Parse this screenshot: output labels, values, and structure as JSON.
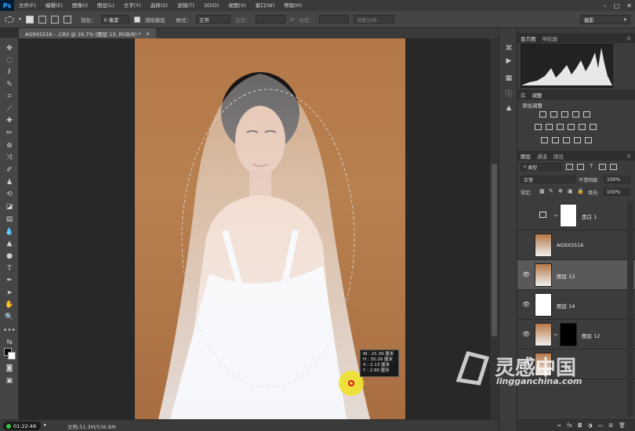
{
  "app": {
    "logo": "Ps"
  },
  "menu": [
    "文件(F)",
    "编辑(E)",
    "图像(I)",
    "图层(L)",
    "文字(Y)",
    "选择(S)",
    "滤镜(T)",
    "3D(D)",
    "视图(V)",
    "窗口(W)",
    "帮助(H)"
  ],
  "window_controls": [
    "–",
    "▢",
    "✕"
  ],
  "options": {
    "feather_label": "羽化：",
    "feather_value": "0 像素",
    "antialias_label": "消除锯齿",
    "style_label": "样式：",
    "style_value": "正常",
    "width_label": "宽度：",
    "height_label": "高度：",
    "refine_label": "调整边缘...",
    "workspace": "摄影"
  },
  "document": {
    "tab_title": "AG9X5516 - .CR2 @ 16.7% (图层 13, RGB/8) *",
    "close_glyph": "×"
  },
  "info_readout": {
    "w": "W :  21.39 厘米",
    "h": "H :  35.26 厘米",
    "x": "X :   2.13 厘米",
    "y": "Y :   2.90 厘米"
  },
  "status": {
    "timer": "01:22:48",
    "doc_size": "文档:51.3M/536.8M"
  },
  "panels": {
    "histogram_tabs": [
      "直方图",
      "导航器"
    ],
    "adjust_tabs": [
      "库",
      "调整"
    ],
    "adjust_title": "添加调整",
    "layer_tabs": [
      "图层",
      "通道",
      "路径"
    ],
    "filter_type": "类型",
    "blend_mode": "正常",
    "opacity_label": "不透明度:",
    "opacity_value": "100%",
    "lock_label": "锁定:",
    "fill_label": "填充:",
    "fill_value": "100%",
    "layers": [
      {
        "name": "黑白 1",
        "visible": false,
        "kind": "adjustment"
      },
      {
        "name": "AG9X5516",
        "visible": false,
        "kind": "photo"
      },
      {
        "name": "图层 13",
        "visible": true,
        "kind": "photo",
        "selected": true
      },
      {
        "name": "图层 14",
        "visible": true,
        "kind": "white"
      },
      {
        "name": "图层 12",
        "visible": true,
        "kind": "photo-mask"
      },
      {
        "name": "",
        "visible": true,
        "kind": "photo"
      }
    ],
    "footer_icons": [
      "link-icon",
      "fx-icon",
      "mask-icon",
      "adjust-icon",
      "folder-icon",
      "new-layer-icon",
      "trash-icon"
    ]
  },
  "watermark": {
    "brand": "灵感中国",
    "url": "lingganchina.com"
  },
  "colors": {
    "accent": "#31a8ff",
    "cursor_highlight": "#f0e020",
    "timer_dot": "#3cc43c"
  }
}
